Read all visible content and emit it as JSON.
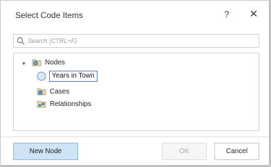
{
  "dialog": {
    "title": "Select Code Items",
    "help_label": "?",
    "close_label": "✕"
  },
  "search": {
    "placeholder": "Search (CTRL+F)"
  },
  "tree": {
    "nodes_label": "Nodes",
    "new_item_value": "Years in Town",
    "cases_label": "Cases",
    "relationships_label": "Relationships"
  },
  "buttons": {
    "new_node": "New Node",
    "ok": "OK",
    "cancel": "Cancel"
  },
  "colors": {
    "accent": "#cfe3f6",
    "accent_border": "#8fb5db",
    "edit_border": "#5a7fbf"
  }
}
